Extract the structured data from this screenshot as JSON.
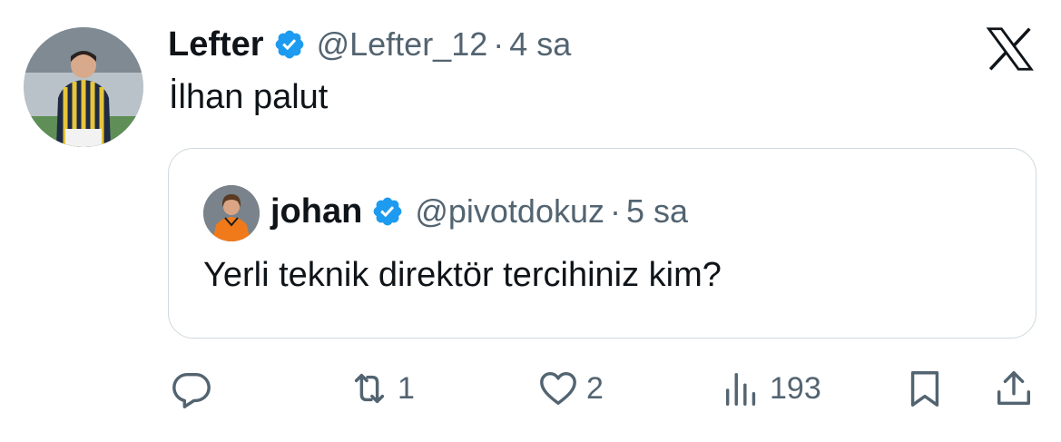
{
  "tweet": {
    "author_name": "Lefter",
    "handle": "@Lefter_12",
    "separator": "·",
    "time": "4 sa",
    "text": "İlhan palut",
    "avatar_icon": "footballer-photo-avatar"
  },
  "quoted": {
    "author_name": "johan",
    "handle": "@pivotdokuz",
    "separator": "·",
    "time": "5 sa",
    "text": "Yerli teknik direktör tercihiniz kim?",
    "avatar_icon": "footballer-orange-jersey-avatar"
  },
  "actions": {
    "reply_icon": "reply-icon",
    "retweet_count": "1",
    "like_count": "2",
    "views_count": "193"
  },
  "colors": {
    "verified_blue": "#1d9bf0",
    "secondary_text": "#536471",
    "primary_text": "#0f1419",
    "border": "#cfd9de"
  }
}
